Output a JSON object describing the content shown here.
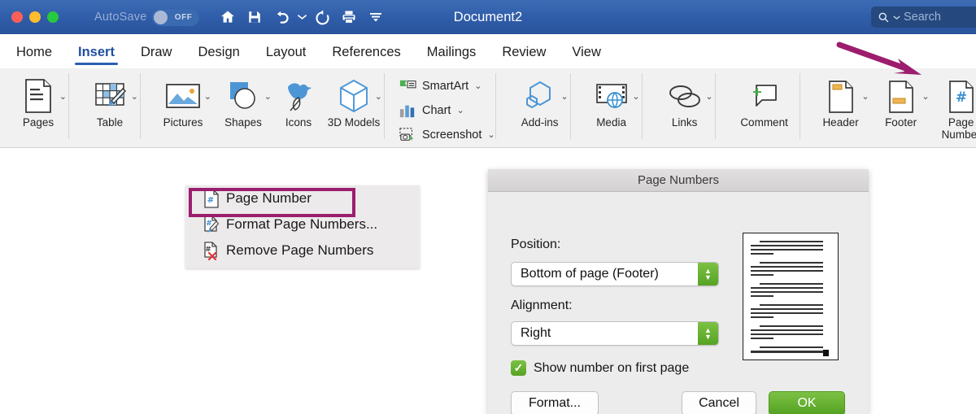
{
  "titlebar": {
    "window_controls": [
      "close",
      "minimize",
      "maximize"
    ],
    "autosave_label": "AutoSave",
    "autosave_state": "OFF",
    "document_title": "Document2",
    "quick_access": [
      {
        "name": "home-icon",
        "label": "Home"
      },
      {
        "name": "save-icon",
        "label": "Save"
      },
      {
        "name": "undo-icon",
        "label": "Undo"
      },
      {
        "name": "undo-chevron-icon",
        "label": "Undo options"
      },
      {
        "name": "redo-icon",
        "label": "Redo"
      },
      {
        "name": "print-icon",
        "label": "Print"
      },
      {
        "name": "customize-toolbar-icon",
        "label": "Customize"
      }
    ],
    "search_placeholder": "Search",
    "bg_color": "#2f5ca8"
  },
  "tabs": {
    "items": [
      {
        "label": "Home",
        "active": false
      },
      {
        "label": "Insert",
        "active": true
      },
      {
        "label": "Draw",
        "active": false
      },
      {
        "label": "Design",
        "active": false
      },
      {
        "label": "Layout",
        "active": false
      },
      {
        "label": "References",
        "active": false
      },
      {
        "label": "Mailings",
        "active": false
      },
      {
        "label": "Review",
        "active": false
      },
      {
        "label": "View",
        "active": false
      }
    ],
    "active_color": "#2b5fb0"
  },
  "ribbon": {
    "groups": [
      {
        "items": [
          {
            "label": "Pages",
            "icon": "page-icon",
            "caret": true
          }
        ]
      },
      {
        "items": [
          {
            "label": "Table",
            "icon": "table-icon",
            "caret": true
          }
        ]
      },
      {
        "items": [
          {
            "label": "Pictures",
            "icon": "pictures-icon",
            "caret": true
          },
          {
            "label": "Shapes",
            "icon": "shapes-icon",
            "caret": true
          },
          {
            "label": "Icons",
            "icon": "icons-icon",
            "caret": false
          },
          {
            "label": "3D Models",
            "icon": "cube-icon",
            "caret": true
          }
        ]
      },
      {
        "stacked": [
          {
            "label": "SmartArt",
            "icon": "smartart-icon",
            "caret": true
          },
          {
            "label": "Chart",
            "icon": "chart-icon",
            "caret": true
          },
          {
            "label": "Screenshot",
            "icon": "screenshot-icon",
            "caret": true
          }
        ]
      },
      {
        "items": [
          {
            "label": "Add-ins",
            "icon": "addins-icon",
            "caret": true
          }
        ]
      },
      {
        "items": [
          {
            "label": "Media",
            "icon": "media-icon",
            "caret": true
          }
        ]
      },
      {
        "items": [
          {
            "label": "Links",
            "icon": "links-icon",
            "caret": true
          }
        ]
      },
      {
        "items": [
          {
            "label": "Comment",
            "icon": "comment-icon",
            "caret": false
          }
        ]
      },
      {
        "items": [
          {
            "label": "Header",
            "icon": "header-icon",
            "caret": true
          },
          {
            "label": "Footer",
            "icon": "footer-icon",
            "caret": true
          },
          {
            "label": "Page Number",
            "icon": "page-number-icon",
            "caret": true
          }
        ]
      }
    ]
  },
  "annotation": {
    "arrow_color": "#9c1d6e",
    "highlight_color": "#9c1d6e"
  },
  "menu": {
    "items": [
      {
        "label": "Page Number",
        "icon": "page-number-icon",
        "highlighted": true
      },
      {
        "label": "Format Page Numbers...",
        "icon": "format-page-numbers-icon",
        "highlighted": false
      },
      {
        "label": "Remove Page Numbers",
        "icon": "remove-page-numbers-icon",
        "highlighted": false
      }
    ]
  },
  "dialog": {
    "title": "Page Numbers",
    "position_label": "Position:",
    "position_value": "Bottom of page (Footer)",
    "alignment_label": "Alignment:",
    "alignment_value": "Right",
    "checkbox_label": "Show number on first page",
    "checkbox_checked": true,
    "buttons": {
      "format": "Format...",
      "cancel": "Cancel",
      "ok": "OK"
    },
    "ok_color": "#56a324"
  }
}
